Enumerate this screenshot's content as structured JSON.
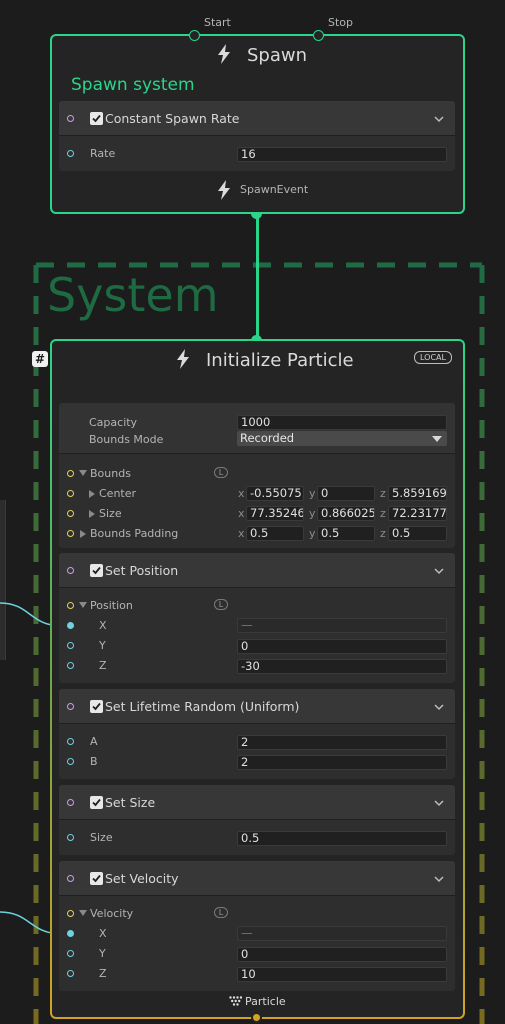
{
  "spawn": {
    "title": "Spawn",
    "start_label": "Start",
    "stop_label": "Stop",
    "system_name": "Spawn system",
    "block": {
      "label": "Constant Spawn Rate",
      "enabled": true
    },
    "rate_label": "Rate",
    "rate_value": "16",
    "output_label": "SpawnEvent"
  },
  "system": {
    "label": "System"
  },
  "init": {
    "title": "Initialize Particle",
    "space_badge": "LOCAL",
    "hash_badge": "#",
    "capacity_label": "Capacity",
    "capacity_value": "1000",
    "bounds_mode_label": "Bounds Mode",
    "bounds_mode_value": "Recorded",
    "bounds_label": "Bounds",
    "space_toggle": "L",
    "center_label": "Center",
    "center": {
      "x": "-0.55075",
      "y": "0",
      "z": "5.859169"
    },
    "size_label": "Size",
    "size": {
      "x": "77.35246",
      "y": "0.866025",
      "z": "72.23177"
    },
    "padding_label": "Bounds Padding",
    "padding": {
      "x": "0.5",
      "y": "0.5",
      "z": "0.5"
    },
    "axis": {
      "x": "x",
      "y": "y",
      "z": "z"
    },
    "set_position": {
      "label": "Set Position",
      "prop": "Position",
      "x_label": "X",
      "x_value": "—",
      "y_label": "Y",
      "y_value": "0",
      "z_label": "Z",
      "z_value": "-30"
    },
    "set_lifetime": {
      "label": "Set Lifetime Random (Uniform)",
      "a_label": "A",
      "a_value": "2",
      "b_label": "B",
      "b_value": "2"
    },
    "set_size": {
      "label": "Set Size",
      "size_label": "Size",
      "size_value": "0.5"
    },
    "set_velocity": {
      "label": "Set Velocity",
      "prop": "Velocity",
      "x_label": "X",
      "x_value": "—",
      "y_label": "Y",
      "y_value": "0",
      "z_label": "Z",
      "z_value": "10"
    },
    "output_label": "Particle"
  },
  "colors": {
    "accent_green": "#2ad58a",
    "system_green": "#1f7a4a",
    "yellow": "#d4a321",
    "cyan": "#6cd3e0",
    "purple": "#c9a0e8"
  }
}
